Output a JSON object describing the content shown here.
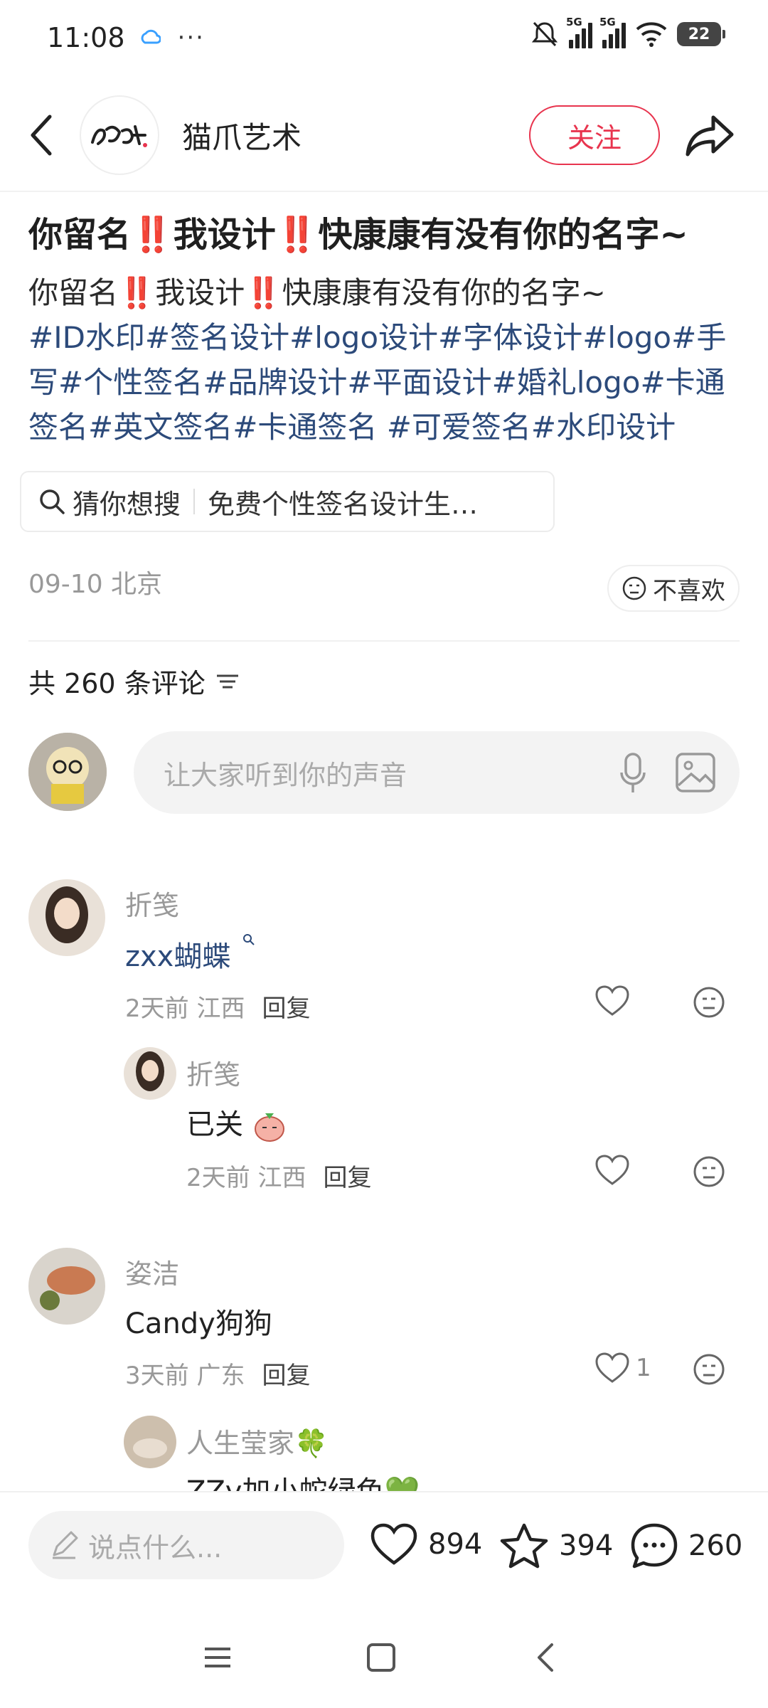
{
  "status": {
    "time": "11:08",
    "dots": "···",
    "net1": "5G",
    "net2": "5G",
    "battery": "22"
  },
  "header": {
    "author_name": "猫爪艺术",
    "follow_label": "关注"
  },
  "post": {
    "title": "你留名‼️我设计‼️快康康有没有你的名字~",
    "body_line": "你留名‼️我设计‼️快康康有没有你的名字~",
    "tags": "#ID水印#签名设计#logo设计#字体设计#logo#手写#个性签名#品牌设计#平面设计#婚礼logo#卡通签名#英文签名#卡通签名 #可爱签名#水印设计",
    "search_label": "猜你想搜",
    "search_query": "免费个性签名设计生…",
    "date_location": "09-10 北京",
    "dislike_label": "不喜欢"
  },
  "comments_header": {
    "count_label": "共 260 条评论",
    "input_placeholder": "让大家听到你的声音"
  },
  "comments": [
    {
      "name": "折笺",
      "text": "zxx蝴蝶",
      "time": "2天前",
      "location": "江西",
      "reply": "回复",
      "likes": ""
    },
    {
      "name": "折笺",
      "text": "已关",
      "time": "2天前",
      "location": "江西",
      "reply": "回复",
      "likes": ""
    },
    {
      "name": "姿洁",
      "text": "Candy狗狗",
      "time": "3天前",
      "location": "广东",
      "reply": "回复",
      "likes": "1"
    },
    {
      "name": "人生莹家🍀",
      "text": "ZZy加小蛇绿色💚"
    }
  ],
  "bottom": {
    "say_placeholder": "说点什么...",
    "likes": "894",
    "stars": "394",
    "comments": "260"
  },
  "colors": {
    "accent": "#e8344e",
    "tag": "#2c4a7a"
  }
}
